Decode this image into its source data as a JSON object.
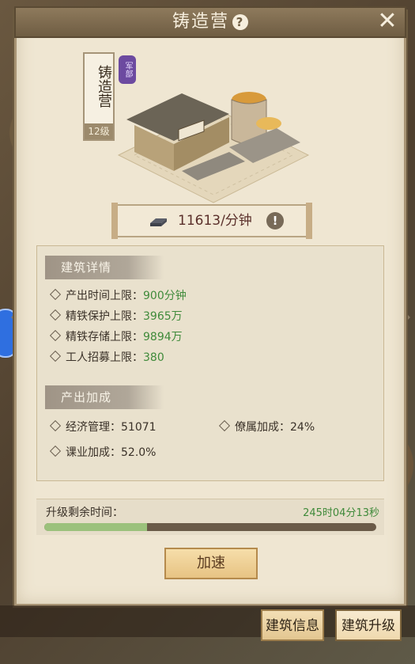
{
  "window": {
    "title": "铸造营"
  },
  "building": {
    "name": "铸造营",
    "level": "12级",
    "seal": "军部"
  },
  "production": {
    "rate": "11613/分钟"
  },
  "details": {
    "section1": "建筑详情",
    "rows": [
      {
        "label": "产出时间上限：",
        "value": "900分钟"
      },
      {
        "label": "精铁保护上限：",
        "value": "3965万"
      },
      {
        "label": "精铁存储上限：",
        "value": "9894万"
      },
      {
        "label": "工人招募上限：",
        "value": "380"
      }
    ],
    "section2": "产出加成",
    "bonus": [
      {
        "label": "经济管理：",
        "value": "51071"
      },
      {
        "label": "僚属加成：",
        "value": "24%"
      },
      {
        "label": "课业加成：",
        "value": "52.0%"
      }
    ]
  },
  "upgrade": {
    "label": "升级剩余时间：",
    "remaining": "245时04分13秒",
    "progress": 0.31
  },
  "buttons": {
    "speedup": "加速",
    "tab_info": "建筑信息",
    "tab_upgrade": "建筑升级"
  },
  "colors": {
    "green_value": "#3f8a3a",
    "accent": "#e7c383"
  }
}
